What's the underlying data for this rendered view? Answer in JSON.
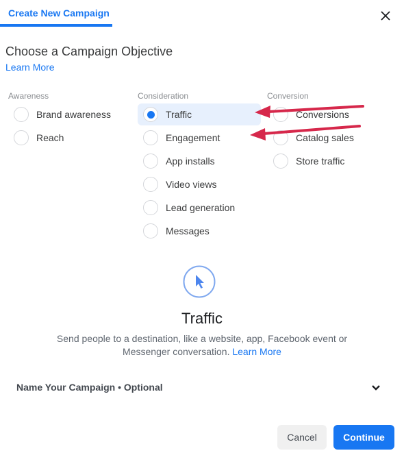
{
  "header": {
    "tab_label": "Create New Campaign",
    "close_icon": "close-icon"
  },
  "objective": {
    "title": "Choose a Campaign Objective",
    "learn_more": "Learn More",
    "columns": [
      {
        "label": "Awareness",
        "options": [
          {
            "label": "Brand awareness",
            "selected": false
          },
          {
            "label": "Reach",
            "selected": false
          }
        ]
      },
      {
        "label": "Consideration",
        "options": [
          {
            "label": "Traffic",
            "selected": true
          },
          {
            "label": "Engagement",
            "selected": false
          },
          {
            "label": "App installs",
            "selected": false
          },
          {
            "label": "Video views",
            "selected": false
          },
          {
            "label": "Lead generation",
            "selected": false
          },
          {
            "label": "Messages",
            "selected": false
          }
        ]
      },
      {
        "label": "Conversion",
        "options": [
          {
            "label": "Conversions",
            "selected": false
          },
          {
            "label": "Catalog sales",
            "selected": false
          },
          {
            "label": "Store traffic",
            "selected": false
          }
        ]
      }
    ]
  },
  "detail": {
    "icon": "cursor-pointer-icon",
    "title": "Traffic",
    "description": "Send people to a destination, like a website, app, Facebook event or Messenger conversation.",
    "learn_more": "Learn More"
  },
  "name_section": {
    "label": "Name Your Campaign • Optional"
  },
  "footer": {
    "cancel_label": "Cancel",
    "continue_label": "Continue"
  },
  "colors": {
    "accent": "#1877f2",
    "selected_bg": "#e7f0fd",
    "annotation_arrow": "#d6284b"
  }
}
